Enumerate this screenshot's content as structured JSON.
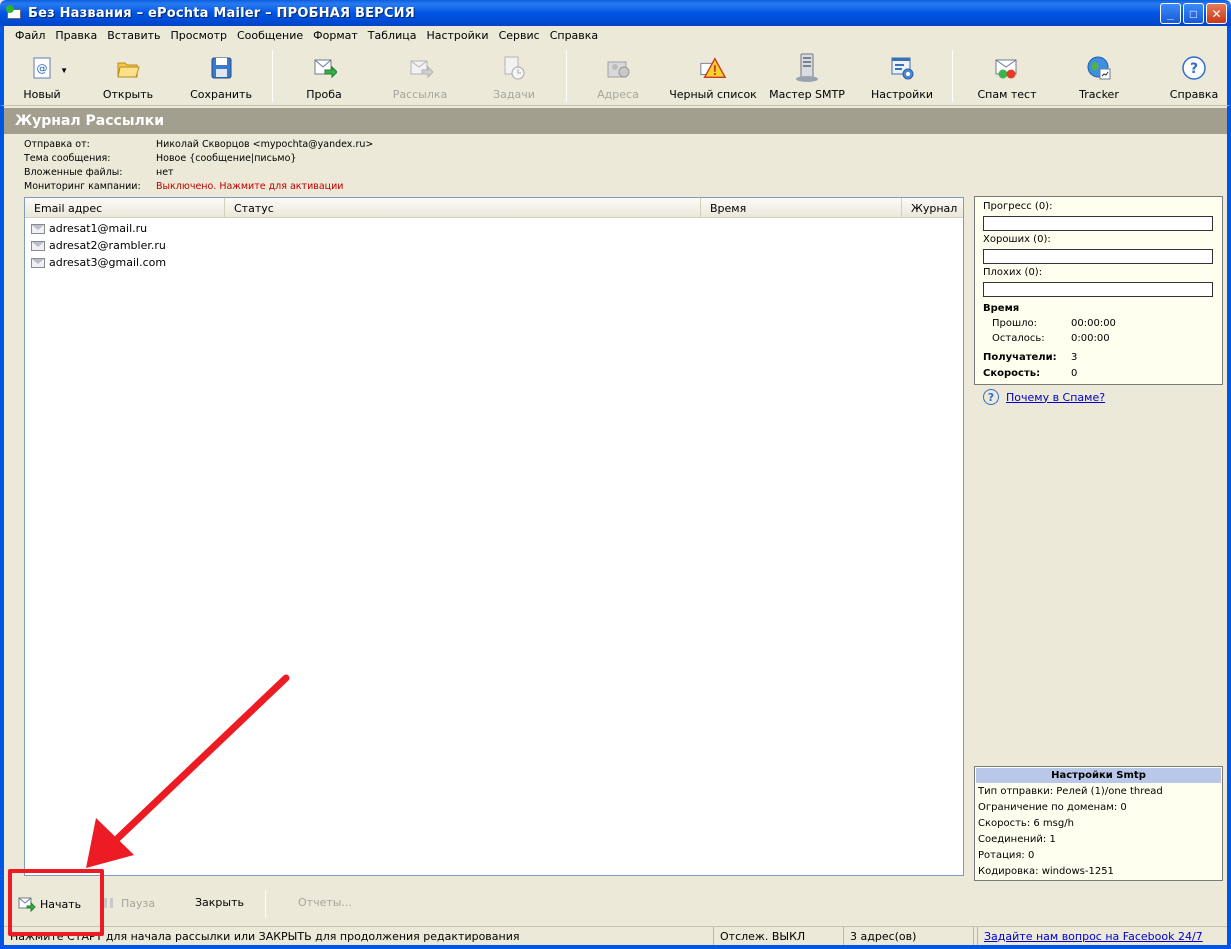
{
  "window": {
    "title": "Без Названия – ePochta Mailer – ПРОБНАЯ ВЕРСИЯ",
    "min": "_",
    "max": "□",
    "close": "✕"
  },
  "menu": [
    "Файл",
    "Правка",
    "Вставить",
    "Просмотр",
    "Сообщение",
    "Формат",
    "Таблица",
    "Настройки",
    "Сервис",
    "Справка"
  ],
  "toolbar": {
    "new": "Новый",
    "open": "Открыть",
    "save": "Сохранить",
    "test": "Проба",
    "mailing": "Рассылка",
    "tasks": "Задачи",
    "addresses": "Адреса",
    "blacklist": "Черный список",
    "smtp_master": "Мастер SMTP",
    "settings": "Настройки",
    "spam_test": "Спам тест",
    "tracker": "Tracker",
    "help": "Справка"
  },
  "journal": {
    "title": "Журнал Рассылки"
  },
  "info": {
    "from_label": "Отправка от:",
    "from_value": "Николай Скворцов <mypochta@yandex.ru>",
    "subject_label": "Тема сообщения:",
    "subject_value": "Новое {сообщение|письмо}",
    "attach_label": "Вложенные файлы:",
    "attach_value": "нет",
    "monitor_label": "Мониторинг кампании:",
    "monitor_value": "Выключено. Нажмите для активации"
  },
  "list": {
    "columns": [
      "Email адрес",
      "Статус",
      "Время",
      "Журнал"
    ],
    "rows": [
      "adresat1@mail.ru",
      "adresat2@rambler.ru",
      "adresat3@gmail.com"
    ]
  },
  "stats": {
    "progress": "Прогресс (0):",
    "good": "Хороших (0):",
    "bad": "Плохих (0):",
    "time": "Время",
    "elapsed_label": "Прошло:",
    "elapsed": "00:00:00",
    "remaining_label": "Осталось:",
    "remaining": "0:00:00",
    "recipients_label": "Получатели:",
    "recipients": "3",
    "speed_label": "Скорость:",
    "speed": "0",
    "progress_fraction": 0,
    "good_fraction": 0,
    "bad_fraction": 0
  },
  "help_link": "Почему в Спаме?",
  "smtp": {
    "title": "Настройки Smtp",
    "lines": [
      "Тип отправки: Релей (1)/one thread",
      "Ограничение по доменам: 0",
      "Скорость: 6 msg/h",
      "Соединений: 1",
      "Ротация: 0",
      "Кодировка: windows-1251"
    ]
  },
  "actions": {
    "start": "Начать",
    "pause": "Пауза",
    "close": "Закрыть",
    "reports": "Отчеты..."
  },
  "status": {
    "hint": "Нажмите СТАРТ для начала рассылки или ЗАКРЫТЬ для продолжения редактирования",
    "tracking": "Отслеж. ВЫКЛ",
    "addresses": "3 адрес(ов)",
    "facebook": "Задайте нам вопрос на Facebook 24/7"
  },
  "colors": {
    "titlebar": "#0055E5",
    "band": "#A39F8F",
    "highlight": "#ED1C24",
    "panel": "#FFFFEF"
  }
}
